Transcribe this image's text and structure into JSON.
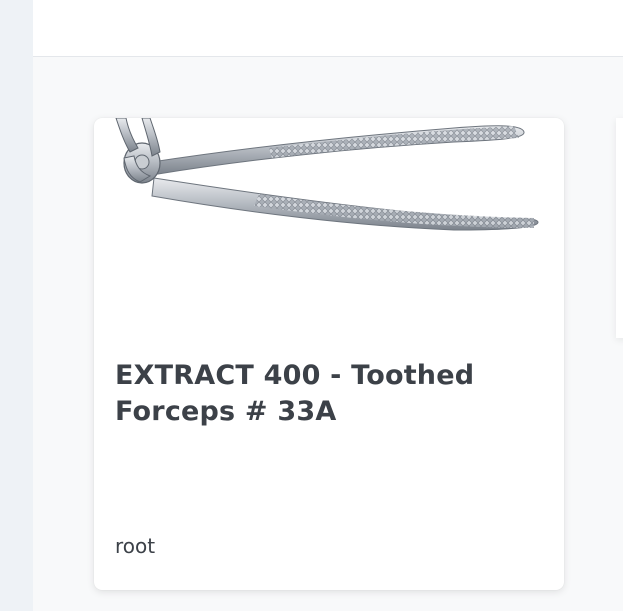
{
  "product_card": {
    "image_icon": "dental-forceps-image",
    "title": "EXTRACT 400 - Toothed Forceps # 33A",
    "category": "root"
  }
}
